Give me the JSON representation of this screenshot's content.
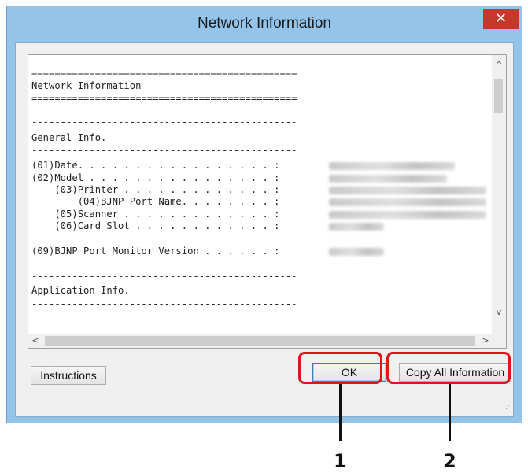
{
  "window": {
    "title": "Network Information",
    "close_glyph": "✕"
  },
  "report": {
    "rule_double": "==============================================",
    "rule_single": "----------------------------------------------",
    "heading": "Network Information",
    "section_general": "General Info.",
    "rows": [
      {
        "label": "(01)Date. . . . . . . . . . . . . . . . . :"
      },
      {
        "label": "(02)Model . . . . . . . . . . . . . . . . :"
      },
      {
        "label": "    (03)Printer . . . . . . . . . . . . . :"
      },
      {
        "label": "        (04)BJNP Port Name. . . . . . . . :"
      },
      {
        "label": "    (05)Scanner . . . . . . . . . . . . . :"
      },
      {
        "label": "    (06)Card Slot . . . . . . . . . . . . :"
      }
    ],
    "bjnp_monitor": "(09)BJNP Port Monitor Version . . . . . . :",
    "section_application": "Application Info."
  },
  "scrollbars": {
    "up_glyph": "^",
    "down_glyph": "v",
    "left_glyph": "<",
    "right_glyph": ">"
  },
  "buttons": {
    "instructions": "Instructions",
    "ok": "OK",
    "copy_all": "Copy All Information"
  },
  "callouts": [
    "1",
    "2"
  ],
  "colors": {
    "highlight": "#e1141c",
    "titlebar": "#94c4ea",
    "close": "#c7382c"
  },
  "icons": {
    "close": "close-icon",
    "resize_grip": "resize-grip-icon"
  }
}
